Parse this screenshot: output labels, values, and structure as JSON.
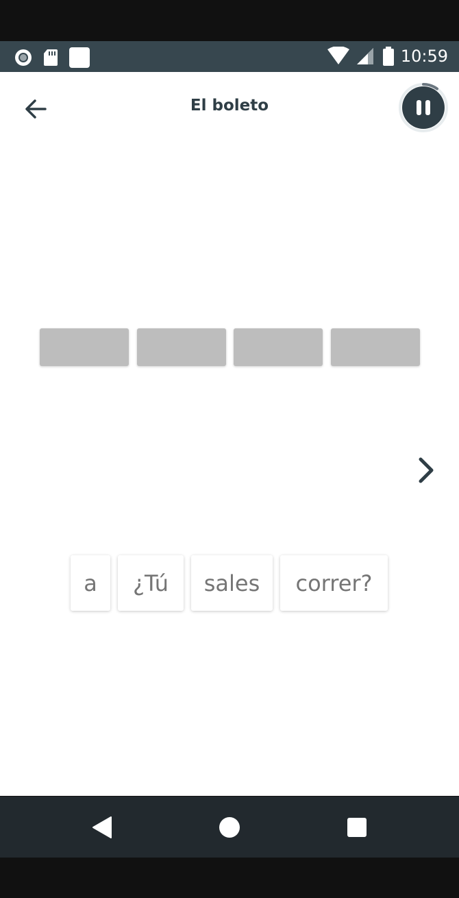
{
  "status_bar": {
    "time": "10:59",
    "left_icons": [
      "record-icon",
      "sd-card-icon",
      "notification-square-icon"
    ],
    "right_icons": [
      "wifi-icon",
      "cell-signal-icon",
      "battery-icon"
    ]
  },
  "header": {
    "title": "El boleto",
    "back_icon": "arrow-left-icon",
    "pause_icon": "pause-icon",
    "timer_progress_fraction": 0.1
  },
  "exercise": {
    "answer_slot_count": 4,
    "next_icon": "chevron-right-icon",
    "word_choices": [
      "a",
      "¿Tú",
      "sales",
      "correr?"
    ]
  },
  "nav_bar": {
    "buttons": [
      "back-triangle-icon",
      "home-circle-icon",
      "recents-square-icon"
    ]
  },
  "colors": {
    "status_bar": "#37474f",
    "app_bar": "#ffffff",
    "title_text": "#2f3e46",
    "slot_fill": "#bdbdbd",
    "chip_text": "#757575",
    "nav_bar": "#22292e",
    "pause_button": "#2f3e46"
  }
}
